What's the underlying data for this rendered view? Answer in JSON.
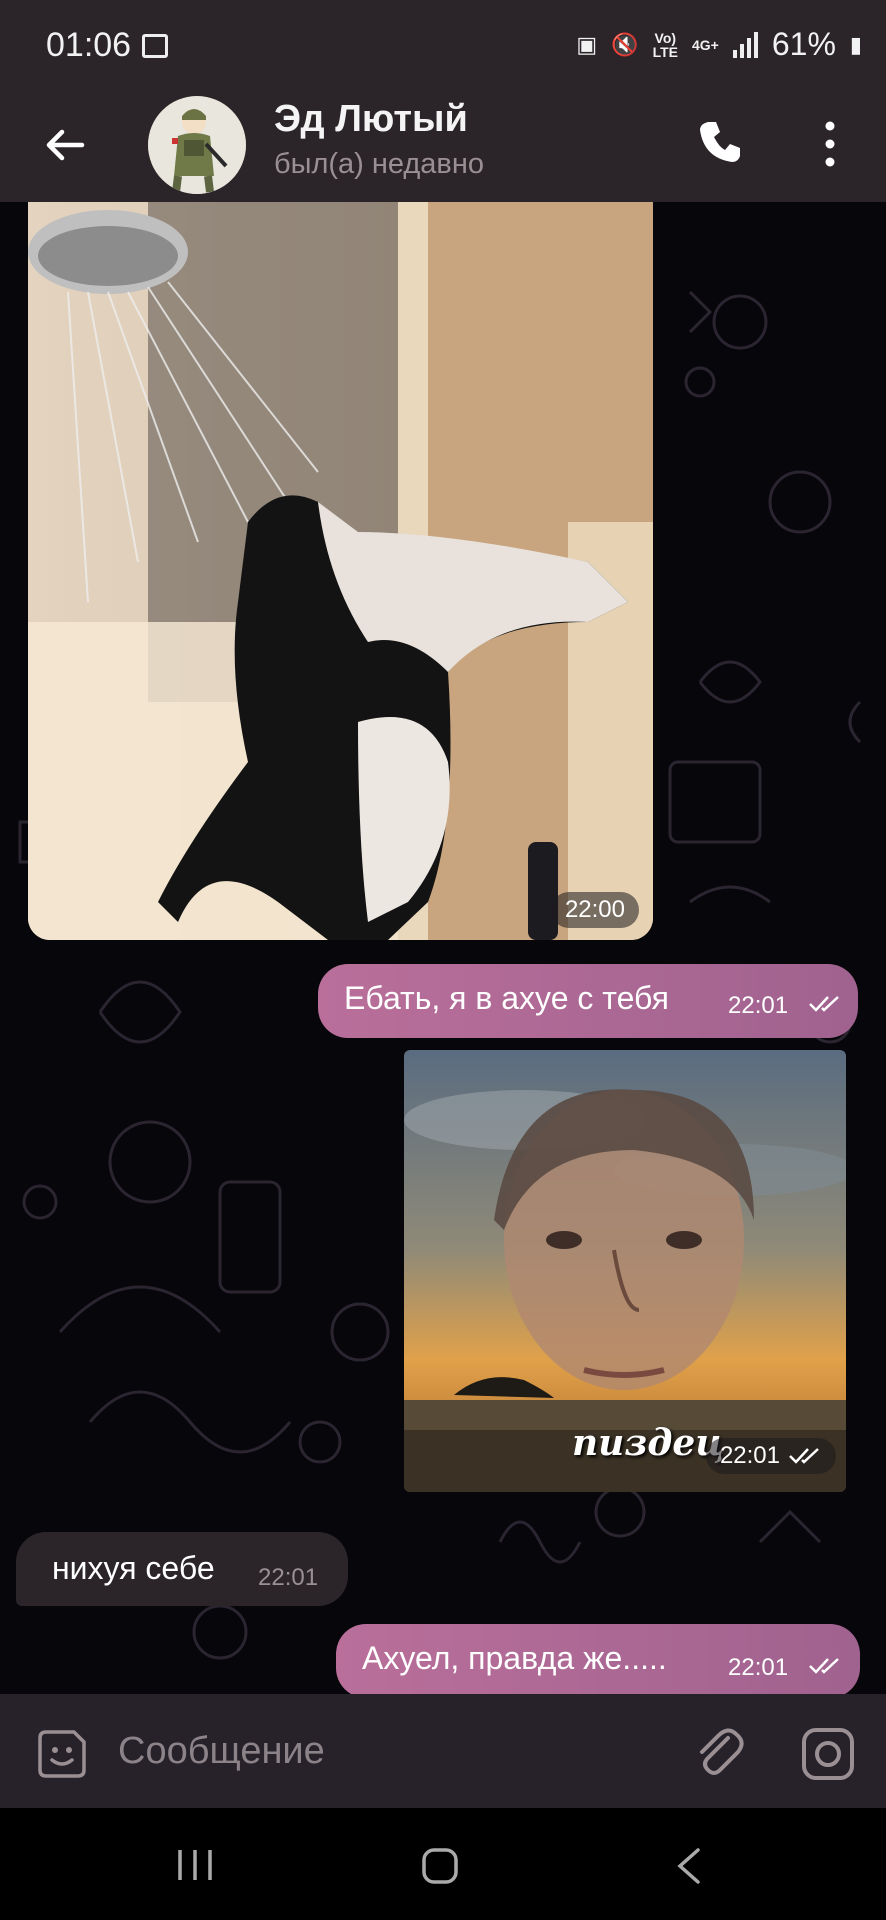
{
  "status_bar": {
    "time": "01:06",
    "network_top": "Vo)",
    "network_bottom": "LTE",
    "network_type": "4G+",
    "battery": "61%"
  },
  "header": {
    "contact_name": "Эд Лютый",
    "contact_status": "был(а) недавно",
    "icons": [
      "back-arrow-icon",
      "phone-icon",
      "more-vert-icon"
    ]
  },
  "messages": [
    {
      "type": "photo",
      "direction": "in",
      "time": "22:00"
    },
    {
      "type": "text",
      "direction": "out",
      "text": "Ебать, я в ахуе с тебя",
      "time": "22:01",
      "read": true
    },
    {
      "type": "photo",
      "direction": "out",
      "caption": "пиздец",
      "time": "22:01",
      "read": true
    },
    {
      "type": "text",
      "direction": "in",
      "text": "нихуя себе",
      "time": "22:01"
    },
    {
      "type": "text",
      "direction": "out",
      "text": "Ахуел, правда же.....",
      "time": "22:01",
      "read": true
    }
  ],
  "input": {
    "placeholder": "Сообщение",
    "icons": [
      "sticker-icon",
      "paperclip-icon",
      "camera-icon"
    ]
  },
  "colors": {
    "outgoing_bubble": "#b06a95",
    "incoming_bubble": "#2b2529",
    "header_bg": "#2b2428",
    "chat_bg": "#07060a"
  }
}
